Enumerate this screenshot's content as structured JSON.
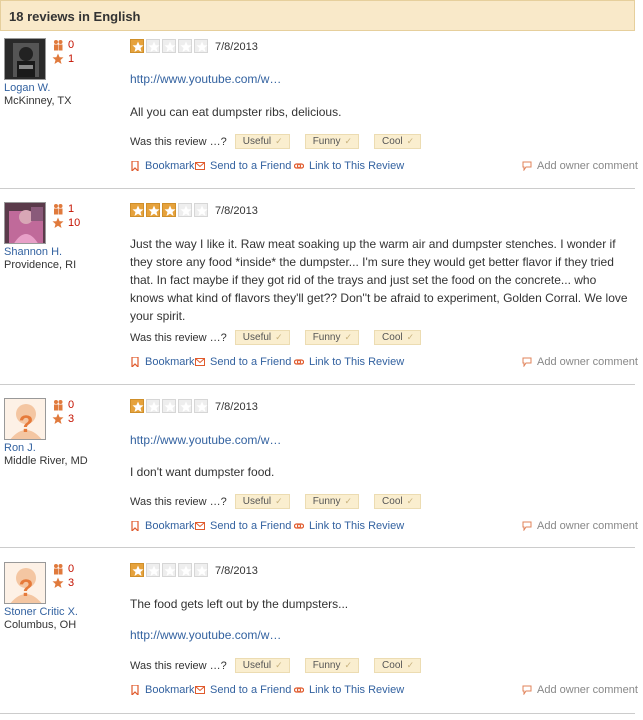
{
  "header": {
    "title": "18 reviews in English"
  },
  "vote": {
    "question": "Was this review …?",
    "useful": "Useful",
    "funny": "Funny",
    "cool": "Cool"
  },
  "actions": {
    "bookmark": "Bookmark",
    "send": "Send to a Friend",
    "link": "Link to This Review",
    "owner": "Add owner comment"
  },
  "colors": {
    "header_bg": "#f9e9c9",
    "star_on": "#e6a23c",
    "link": "#3362a0",
    "count": "#c41200"
  },
  "reviews": [
    {
      "user": "Logan W.",
      "location": "McKinney, TX",
      "friends": "0",
      "review_count": "1",
      "rating": 1,
      "date": "7/8/2013",
      "link": "http://www.youtube.com/w…",
      "text": "All you can eat dumpster ribs, delicious.",
      "avatar": "photo-dark"
    },
    {
      "user": "Shannon H.",
      "location": "Providence, RI",
      "friends": "1",
      "review_count": "10",
      "rating": 3,
      "date": "7/8/2013",
      "text": "Just the way I like it. Raw meat soaking up the warm air and dumpster stenches. I wonder if they store any food *inside* the dumpster... I'm sure they would get better flavor if they tried that. In fact maybe if they got rid of the trays and just set the food on the concrete... who knows what kind of flavors they'll get?? Don''t be afraid to experiment, Golden Corral. We love your spirit.",
      "avatar": "photo-pink"
    },
    {
      "user": "Ron J.",
      "location": "Middle River, MD",
      "friends": "0",
      "review_count": "3",
      "rating": 1,
      "date": "7/8/2013",
      "link": "http://www.youtube.com/w…",
      "text": "I don't want dumpster food.",
      "avatar": "default-silhouette"
    },
    {
      "user": "Stoner Critic X.",
      "location": "Columbus, OH",
      "friends": "0",
      "review_count": "3",
      "rating": 1,
      "date": "7/8/2013",
      "text": "The food gets left out by the dumpsters...",
      "link": "http://www.youtube.com/w…",
      "avatar": "default-silhouette"
    }
  ]
}
